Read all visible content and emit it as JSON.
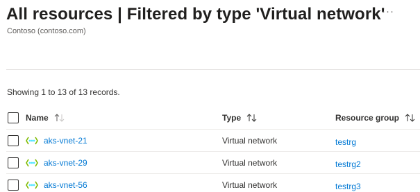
{
  "header": {
    "title": "All resources | Filtered by type 'Virtual network'",
    "subtitle": "Contoso (contoso.com)",
    "more_label": "···"
  },
  "records_info": "Showing 1 to 13 of 13 records.",
  "table": {
    "columns": [
      {
        "label": "Name"
      },
      {
        "label": "Type"
      },
      {
        "label": "Resource group"
      }
    ],
    "rows": [
      {
        "name": "aks-vnet-21",
        "type": "Virtual network",
        "resource_group": "testrg"
      },
      {
        "name": "aks-vnet-29",
        "type": "Virtual network",
        "resource_group": "testrg2"
      },
      {
        "name": "aks-vnet-56",
        "type": "Virtual network",
        "resource_group": "testrg3"
      }
    ]
  },
  "colors": {
    "link": "#0078d4",
    "vnet_icon_dots": "#50e6ff",
    "vnet_icon_brackets": "#7fba00"
  },
  "icons": {
    "more": "more-icon",
    "sort": "sort-icon",
    "row_type": "virtual-network-icon"
  }
}
